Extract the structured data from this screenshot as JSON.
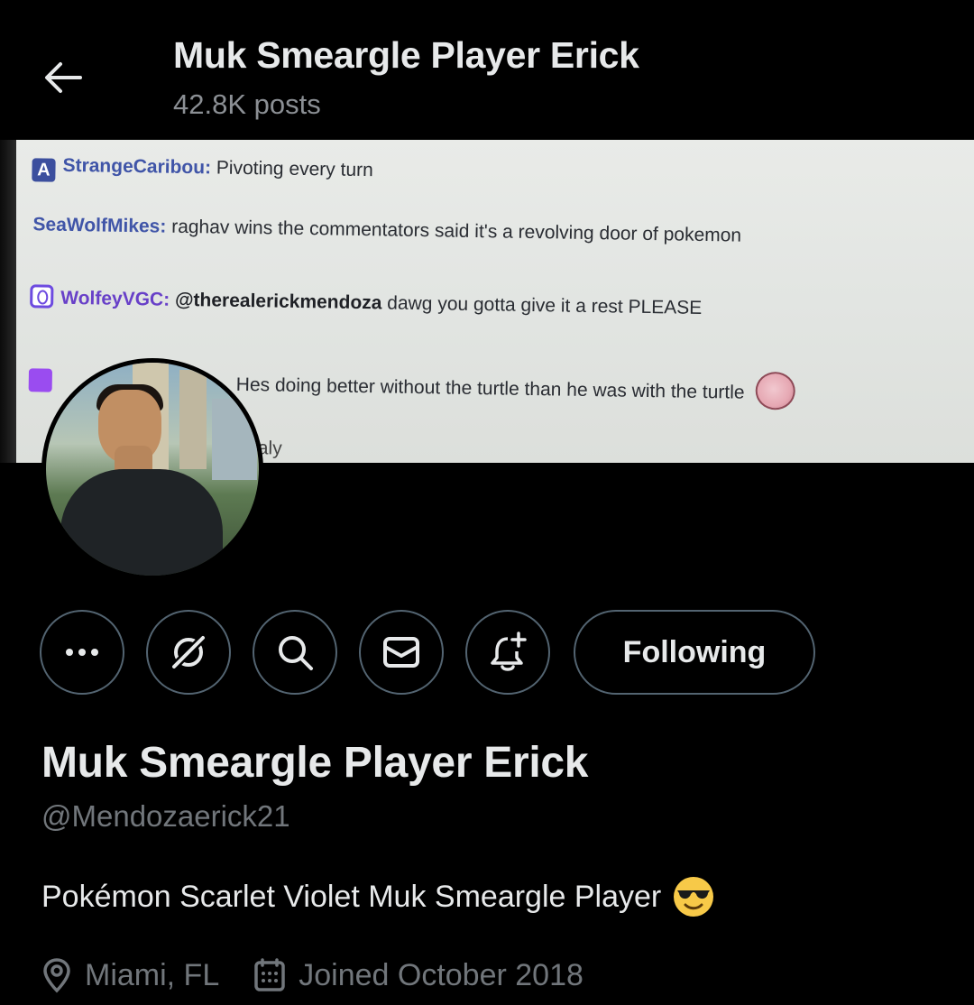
{
  "header": {
    "title": "Muk Smeargle Player Erick",
    "posts": "42.8K posts"
  },
  "banner": {
    "chat": [
      {
        "user": "StrangeCaribou:",
        "text": " Pivoting every turn"
      },
      {
        "user": "SeaWolfMikes:",
        "text": " raghav wins the commentators said it's a revolving door of pokemon"
      },
      {
        "user": "WolfeyVGC:",
        "text": " @therealerickmendoza dawg you gotta give it a rest PLEASE"
      },
      {
        "user": "",
        "text": "Hes doing better without the turtle than he was with the turtle"
      },
      {
        "user": "Caly",
        "text": ""
      }
    ],
    "mention": "@therealerickmendoza"
  },
  "actions": {
    "following_label": "Following"
  },
  "profile": {
    "name": "Muk Smeargle Player Erick",
    "handle": "@Mendozaerick21",
    "bio": "Pokémon Scarlet Violet Muk Smeargle Player",
    "location": "Miami, FL",
    "joined": "Joined October 2018"
  },
  "colors": {
    "background": "#000000",
    "text_primary": "#e7e9ea",
    "text_secondary": "#71767b",
    "button_border": "#536471"
  }
}
